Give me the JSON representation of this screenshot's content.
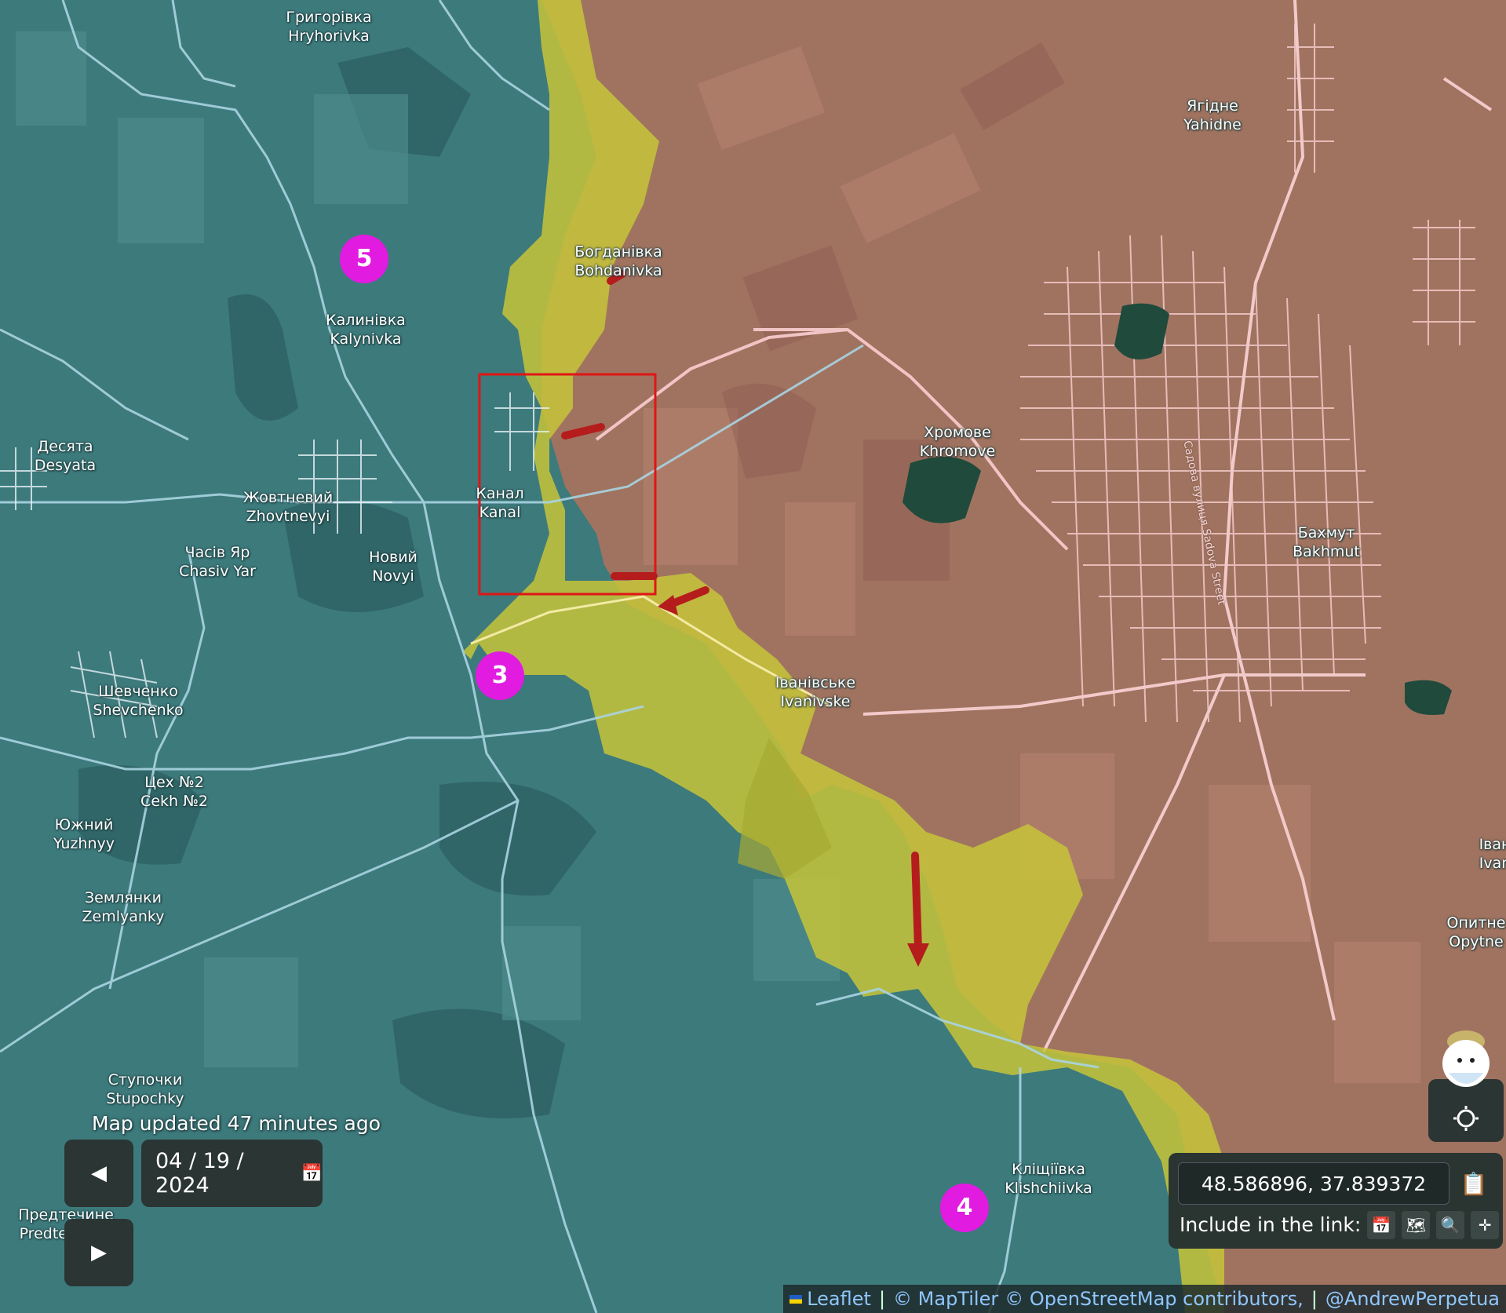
{
  "map": {
    "places": [
      {
        "id": "hryhorivka",
        "uk": "Григорівка",
        "en": "Hryhorivka"
      },
      {
        "id": "yahidne",
        "uk": "Ягідне",
        "en": "Yahidne"
      },
      {
        "id": "bohdanivka",
        "uk": "Богданівка",
        "en": "Bohdanivka"
      },
      {
        "id": "kalynivka",
        "uk": "Калинівка",
        "en": "Kalynivka"
      },
      {
        "id": "desyata",
        "uk": "Десята",
        "en": "Desyata"
      },
      {
        "id": "zhovtnevyi",
        "uk": "Жовтневий",
        "en": "Zhovtnevyi"
      },
      {
        "id": "kanal",
        "uk": "Канал",
        "en": "Kanal"
      },
      {
        "id": "chasivyar",
        "uk": "Часів Яр",
        "en": "Chasiv Yar"
      },
      {
        "id": "novyi",
        "uk": "Новий",
        "en": "Novyi"
      },
      {
        "id": "khromove",
        "uk": "Хромове",
        "en": "Khromove"
      },
      {
        "id": "bakhmut",
        "uk": "Бахмут",
        "en": "Bakhmut"
      },
      {
        "id": "shevchenko",
        "uk": "Шевченко",
        "en": "Shevchenko"
      },
      {
        "id": "ivanivske",
        "uk": "Іванівське",
        "en": "Ivanivske"
      },
      {
        "id": "cekh2",
        "uk": "Цех №2",
        "en": "Cekh №2"
      },
      {
        "id": "yuzhnyi",
        "uk": "Южний",
        "en": "Yuzhnyy"
      },
      {
        "id": "zemlyanky",
        "uk": "Землянки",
        "en": "Zemlyanky"
      },
      {
        "id": "opytne",
        "uk": "Опитне",
        "en": "Opytne"
      },
      {
        "id": "ivan_edge",
        "uk": "Іван",
        "en": "Ivan"
      },
      {
        "id": "stupochky",
        "uk": "Ступочки",
        "en": "Stupochky"
      },
      {
        "id": "klishchiivka",
        "uk": "Кліщіївка",
        "en": "Klishchiivka"
      },
      {
        "id": "predtechyne",
        "uk": "Предтечине",
        "en": "Predtechyne"
      }
    ],
    "street_label": "Садова вулиця Sadova Street",
    "markers": [
      {
        "id": "m5",
        "label": "5"
      },
      {
        "id": "m3",
        "label": "3"
      },
      {
        "id": "m4",
        "label": "4"
      }
    ],
    "colors": {
      "ukraine_controlled": "#3f7b80",
      "russian_controlled": "#a87564",
      "contested": "#c4c23a",
      "highlight_box": "#e01515",
      "attack_arrow": "#b51d1d",
      "marker": "#e11be0"
    }
  },
  "status": {
    "updated": "Map updated 47 minutes ago"
  },
  "controls": {
    "prev_icon": "◀",
    "next_icon": "▶",
    "date": "04 / 19 / 2024",
    "calendar_icon": "📅"
  },
  "coords": {
    "value": "48.586896, 37.839372",
    "copy_icon": "📋",
    "include_label": "Include in the link:",
    "options": [
      {
        "name": "date-option-icon",
        "glyph": "📅"
      },
      {
        "name": "map-option-icon",
        "glyph": "🗺"
      },
      {
        "name": "zoom-option-icon",
        "glyph": "🔍"
      },
      {
        "name": "crosshair-option-icon",
        "glyph": "✛"
      }
    ]
  },
  "attribution": {
    "leaflet": "Leaflet",
    "maptiler": "© MapTiler",
    "osm": "© OpenStreetMap contributors,",
    "author": "@AndrewPerpetua"
  }
}
